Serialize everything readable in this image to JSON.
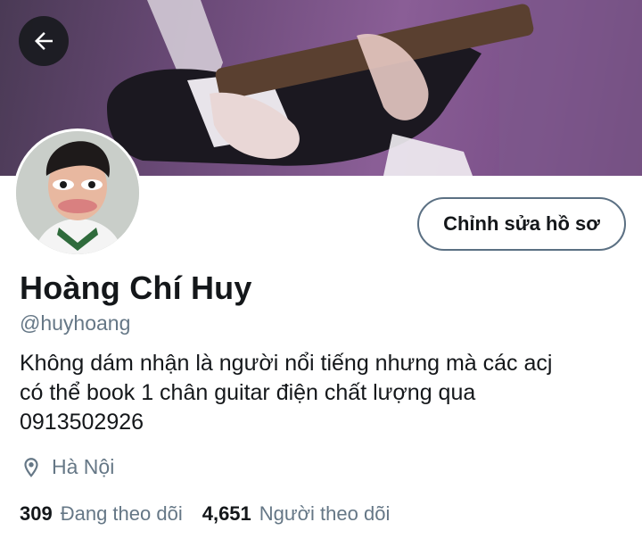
{
  "header": {
    "back_icon": "arrow-left-icon"
  },
  "profile": {
    "name": "Hoàng Chí Huy",
    "handle": "@huyhoang",
    "bio_lines": [
      "Không dám nhận là người nổi tiếng nhưng mà các acj",
      "có thể book 1 chân guitar điện chất lượng qua",
      "0913502926"
    ],
    "location": "Hà Nội",
    "location_icon": "map-pin-icon",
    "edit_button": "Chỉnh sửa hồ sơ"
  },
  "stats": {
    "following_count": "309",
    "following_label": "Đang theo dõi",
    "followers_count": "4,651",
    "followers_label": "Người theo dõi"
  },
  "colors": {
    "text_primary": "#14171a",
    "text_secondary": "#657786",
    "button_border": "#5b7083",
    "banner_tint": "#7a4f88"
  }
}
